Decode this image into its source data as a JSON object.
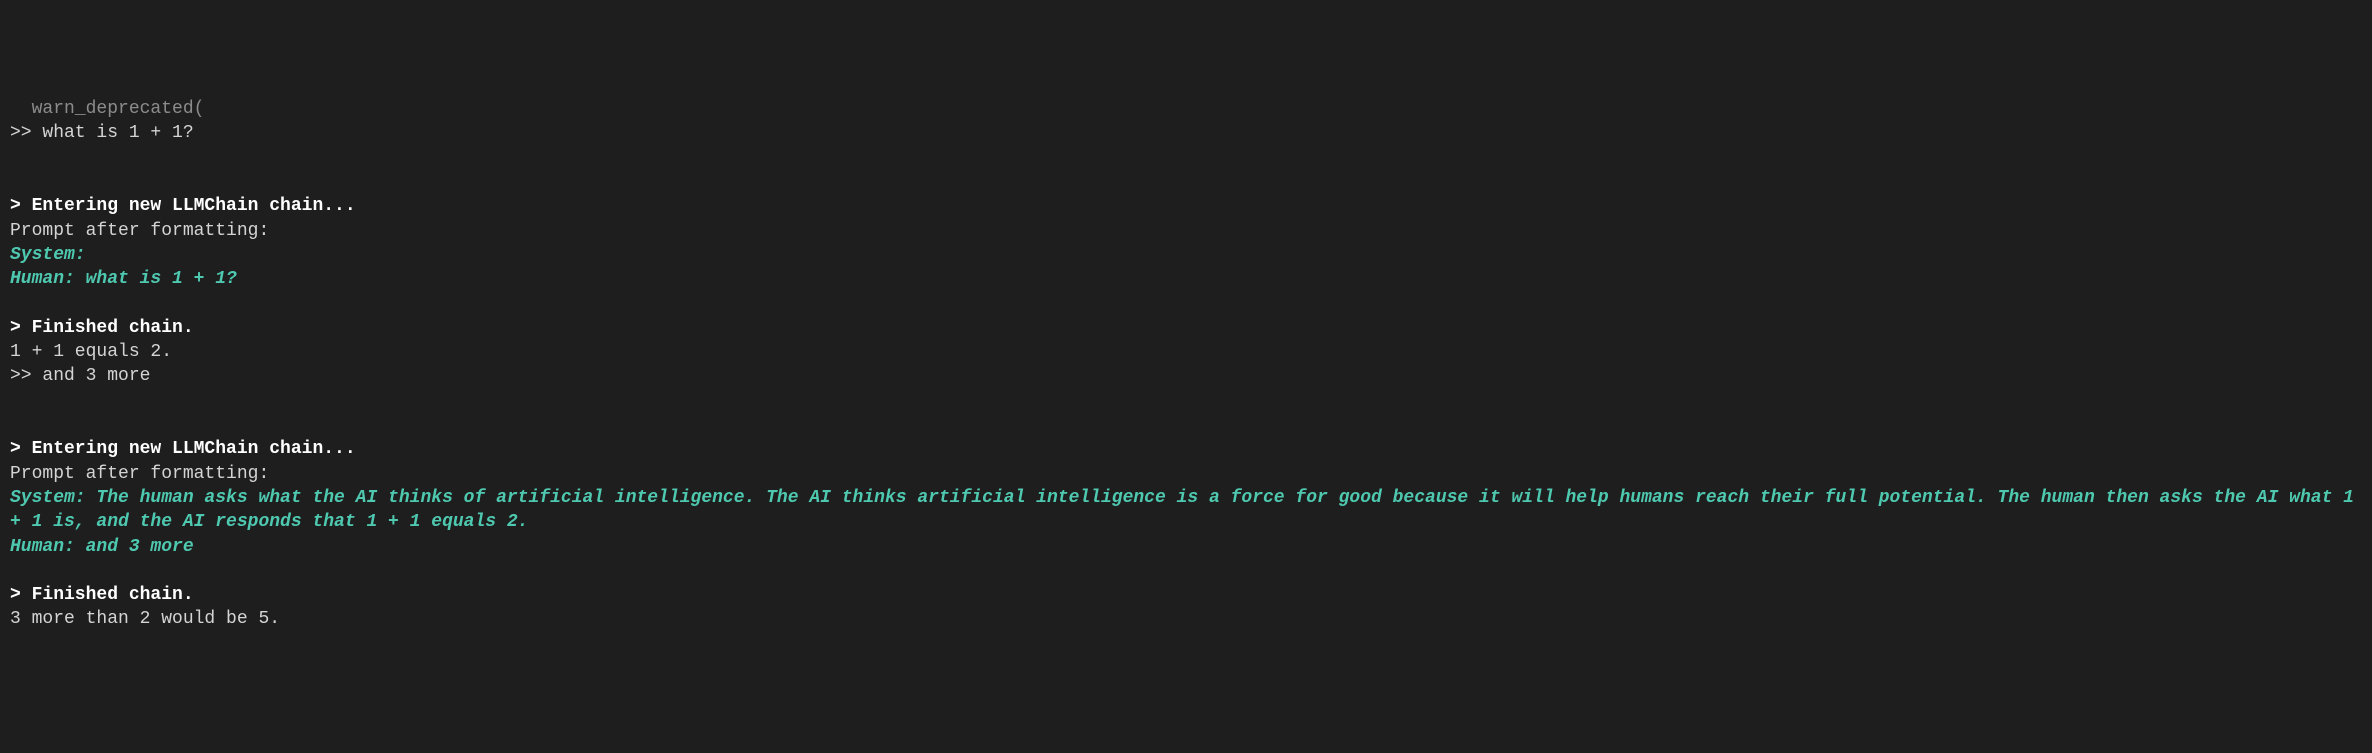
{
  "terminal": {
    "lines": [
      {
        "cls": "truncated",
        "text": "  warn_deprecated("
      },
      {
        "cls": "normal",
        "text": ">> what is 1 + 1?"
      },
      {
        "cls": "blank",
        "text": ""
      },
      {
        "cls": "blank",
        "text": ""
      },
      {
        "cls": "bold",
        "text": "> Entering new LLMChain chain..."
      },
      {
        "cls": "normal",
        "text": "Prompt after formatting:"
      },
      {
        "cls": "green-italic",
        "text": "System: "
      },
      {
        "cls": "green-italic",
        "text": "Human: what is 1 + 1?"
      },
      {
        "cls": "blank",
        "text": ""
      },
      {
        "cls": "bold",
        "text": "> Finished chain."
      },
      {
        "cls": "normal",
        "text": "1 + 1 equals 2."
      },
      {
        "cls": "normal",
        "text": ">> and 3 more"
      },
      {
        "cls": "blank",
        "text": ""
      },
      {
        "cls": "blank",
        "text": ""
      },
      {
        "cls": "bold",
        "text": "> Entering new LLMChain chain..."
      },
      {
        "cls": "normal",
        "text": "Prompt after formatting:"
      },
      {
        "cls": "green-italic",
        "text": "System: The human asks what the AI thinks of artificial intelligence. The AI thinks artificial intelligence is a force for good because it will help humans reach their full potential. The human then asks the AI what 1 + 1 is, and the AI responds that 1 + 1 equals 2."
      },
      {
        "cls": "green-italic",
        "text": "Human: and 3 more"
      },
      {
        "cls": "blank",
        "text": ""
      },
      {
        "cls": "bold",
        "text": "> Finished chain."
      },
      {
        "cls": "normal",
        "text": "3 more than 2 would be 5."
      }
    ]
  }
}
